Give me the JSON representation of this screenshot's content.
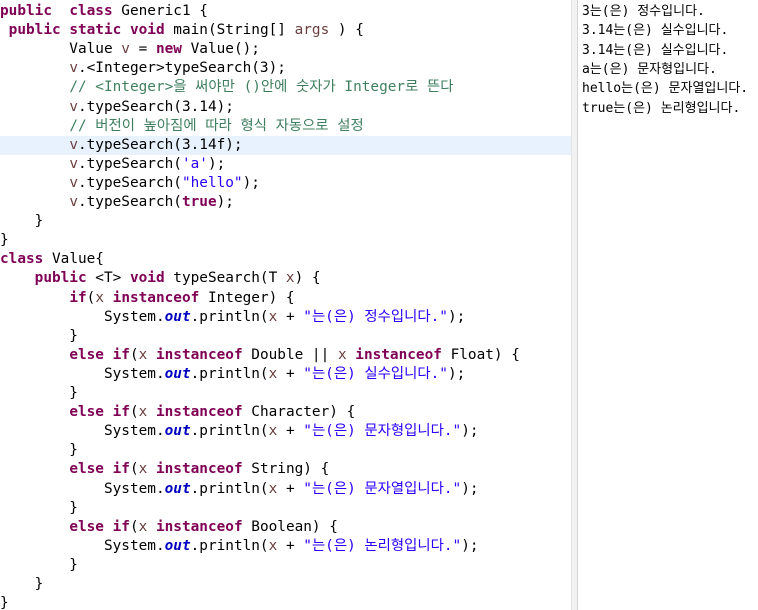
{
  "colors": {
    "keyword": "#7f0055",
    "comment": "#3f7f5f",
    "string": "#2a00ff",
    "field": "#0000c0",
    "variable": "#6a3e3e",
    "current_line": "#e8f2fe"
  },
  "editor": {
    "current_line": 9,
    "lines": [
      [
        [
          "kw",
          "public"
        ],
        [
          "",
          "  "
        ],
        [
          "kw",
          "class"
        ],
        [
          "",
          " Generic1 {"
        ]
      ],
      [
        [
          "",
          " "
        ],
        [
          "kw",
          "public"
        ],
        [
          "",
          ""
        ],
        [
          "kw",
          " static"
        ],
        [
          "",
          " "
        ],
        [
          "kw",
          "void"
        ],
        [
          "",
          " main(String[] "
        ],
        [
          "var",
          "args"
        ],
        [
          "",
          " ) {"
        ]
      ],
      [
        [
          "",
          "        Value "
        ],
        [
          "var",
          "v"
        ],
        [
          "",
          " = "
        ],
        [
          "kw",
          "new"
        ],
        [
          "",
          " Value();"
        ]
      ],
      [
        [
          "",
          "        "
        ],
        [
          "var",
          "v"
        ],
        [
          "",
          ".<Integer>typeSearch(3);"
        ]
      ],
      [
        [
          "",
          "        "
        ],
        [
          "cm",
          "// <Integer>을 써야만 ()안에 숫자가 Integer로 뜬다"
        ]
      ],
      [
        [
          "",
          "        "
        ],
        [
          "var",
          "v"
        ],
        [
          "",
          ".typeSearch(3.14);"
        ]
      ],
      [
        [
          "",
          "        "
        ],
        [
          "cm",
          "// 버전이 높아짐에 따라 형식 자동으로 설정"
        ]
      ],
      [
        [
          "",
          "        "
        ],
        [
          "var",
          "v"
        ],
        [
          "",
          ".typeSearch(3.14f);"
        ]
      ],
      [
        [
          "",
          "        "
        ],
        [
          "var",
          "v"
        ],
        [
          "",
          ".typeSearch("
        ],
        [
          "str",
          "'a'"
        ],
        [
          "",
          ");"
        ]
      ],
      [
        [
          "",
          "        "
        ],
        [
          "var",
          "v"
        ],
        [
          "",
          ".typeSearch("
        ],
        [
          "str",
          "\"hello\""
        ],
        [
          "",
          ");"
        ]
      ],
      [
        [
          "",
          "        "
        ],
        [
          "var",
          "v"
        ],
        [
          "",
          ".typeSearch("
        ],
        [
          "kw",
          "true"
        ],
        [
          "",
          ");"
        ]
      ],
      [
        [
          "",
          "    }"
        ]
      ],
      [
        [
          "",
          "}"
        ]
      ],
      [
        [
          "kw",
          "class"
        ],
        [
          "",
          " Value{"
        ]
      ],
      [
        [
          "",
          "    "
        ],
        [
          "kw",
          "public"
        ],
        [
          "",
          " <T> "
        ],
        [
          "kw",
          "void"
        ],
        [
          "",
          " typeSearch(T "
        ],
        [
          "var",
          "x"
        ],
        [
          "",
          ") {"
        ]
      ],
      [
        [
          "",
          "        "
        ],
        [
          "kw",
          "if"
        ],
        [
          "",
          "("
        ],
        [
          "var",
          "x"
        ],
        [
          "",
          " "
        ],
        [
          "kw",
          "instanceof"
        ],
        [
          "",
          " Integer) {"
        ]
      ],
      [
        [
          "",
          "            System."
        ],
        [
          "fld",
          "out"
        ],
        [
          "",
          ".println("
        ],
        [
          "var",
          "x"
        ],
        [
          "",
          " + "
        ],
        [
          "str",
          "\"는(은) 정수입니다.\""
        ],
        [
          "",
          ");"
        ]
      ],
      [
        [
          "",
          "        }"
        ]
      ],
      [
        [
          "",
          "        "
        ],
        [
          "kw",
          "else"
        ],
        [
          "",
          " "
        ],
        [
          "kw",
          "if"
        ],
        [
          "",
          "("
        ],
        [
          "var",
          "x"
        ],
        [
          "",
          " "
        ],
        [
          "kw",
          "instanceof"
        ],
        [
          "",
          " Double || "
        ],
        [
          "var",
          "x"
        ],
        [
          "",
          " "
        ],
        [
          "kw",
          "instanceof"
        ],
        [
          "",
          " Float) {"
        ]
      ],
      [
        [
          "",
          "            System."
        ],
        [
          "fld",
          "out"
        ],
        [
          "",
          ".println("
        ],
        [
          "var",
          "x"
        ],
        [
          "",
          " + "
        ],
        [
          "str",
          "\"는(은) 실수입니다.\""
        ],
        [
          "",
          ");"
        ]
      ],
      [
        [
          "",
          "        }"
        ]
      ],
      [
        [
          "",
          "        "
        ],
        [
          "kw",
          "else"
        ],
        [
          "",
          " "
        ],
        [
          "kw",
          "if"
        ],
        [
          "",
          "("
        ],
        [
          "var",
          "x"
        ],
        [
          "",
          " "
        ],
        [
          "kw",
          "instanceof"
        ],
        [
          "",
          " Character) {"
        ]
      ],
      [
        [
          "",
          "            System."
        ],
        [
          "fld",
          "out"
        ],
        [
          "",
          ".println("
        ],
        [
          "var",
          "x"
        ],
        [
          "",
          " + "
        ],
        [
          "str",
          "\"는(은) 문자형입니다.\""
        ],
        [
          "",
          ");"
        ]
      ],
      [
        [
          "",
          "        }"
        ]
      ],
      [
        [
          "",
          "        "
        ],
        [
          "kw",
          "else"
        ],
        [
          "",
          " "
        ],
        [
          "kw",
          "if"
        ],
        [
          "",
          "("
        ],
        [
          "var",
          "x"
        ],
        [
          "",
          " "
        ],
        [
          "kw",
          "instanceof"
        ],
        [
          "",
          " String) {"
        ]
      ],
      [
        [
          "",
          "            System."
        ],
        [
          "fld",
          "out"
        ],
        [
          "",
          ".println("
        ],
        [
          "var",
          "x"
        ],
        [
          "",
          " + "
        ],
        [
          "str",
          "\"는(은) 문자열입니다.\""
        ],
        [
          "",
          ");"
        ]
      ],
      [
        [
          "",
          "        }"
        ]
      ],
      [
        [
          "",
          "        "
        ],
        [
          "kw",
          "else"
        ],
        [
          "",
          " "
        ],
        [
          "kw",
          "if"
        ],
        [
          "",
          "("
        ],
        [
          "var",
          "x"
        ],
        [
          "",
          " "
        ],
        [
          "kw",
          "instanceof"
        ],
        [
          "",
          " Boolean) {"
        ]
      ],
      [
        [
          "",
          "            System."
        ],
        [
          "fld",
          "out"
        ],
        [
          "",
          ".println("
        ],
        [
          "var",
          "x"
        ],
        [
          "",
          " + "
        ],
        [
          "str",
          "\"는(은) 논리형입니다.\""
        ],
        [
          "",
          ");"
        ]
      ],
      [
        [
          "",
          "        }"
        ]
      ],
      [
        [
          "",
          "    }"
        ]
      ],
      [
        [
          "",
          "}"
        ]
      ]
    ]
  },
  "console": {
    "lines": [
      "3는(은) 정수입니다.",
      "3.14는(은) 실수입니다.",
      "3.14는(은) 실수입니다.",
      "a는(은) 문자형입니다.",
      "hello는(은) 문자열입니다.",
      "true는(은) 논리형입니다."
    ]
  }
}
